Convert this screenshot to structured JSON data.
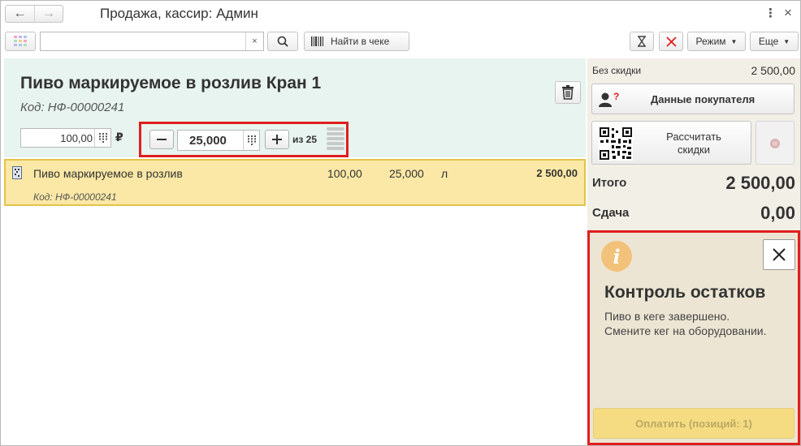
{
  "window": {
    "title": "Продажа, кассир: Админ"
  },
  "toolbar": {
    "search_value": "",
    "search_clear": "×",
    "find_in_check_label": "Найти в чеке",
    "mode_label": "Режим",
    "more_label": "Еще"
  },
  "product": {
    "name": "Пиво маркируемое в розлив Кран 1",
    "code": "Код: НФ-00000241",
    "price": "100,00",
    "currency": "₽",
    "quantity": "25,000",
    "of_total": "из 25"
  },
  "items": [
    {
      "name": "Пиво маркируемое в розлив",
      "price": "100,00",
      "quantity": "25,000",
      "unit": "л",
      "sum": "2 500,00",
      "code": "Код: НФ-00000241"
    }
  ],
  "summary": {
    "no_discount_label": "Без скидки",
    "no_discount_value": "2 500,00",
    "customer_data_label": "Данные покупателя",
    "calc_discounts_line1": "Рассчитать",
    "calc_discounts_line2": "скидки",
    "total_label": "Итого",
    "total_value": "2 500,00",
    "change_label": "Сдача",
    "change_value": "0,00"
  },
  "message": {
    "title": "Контроль остатков",
    "line1": "Пиво в кеге завершено.",
    "line2": "Смените кег на оборудовании.",
    "pay_label": "Оплатить (позиций: 1)"
  },
  "colors": {
    "header_bg": "#e8f4ef",
    "row_bg": "#fbe8a6",
    "highlight": "#e01e1e",
    "right_bg": "#f2efe6",
    "info_icon": "#f2c27a"
  }
}
